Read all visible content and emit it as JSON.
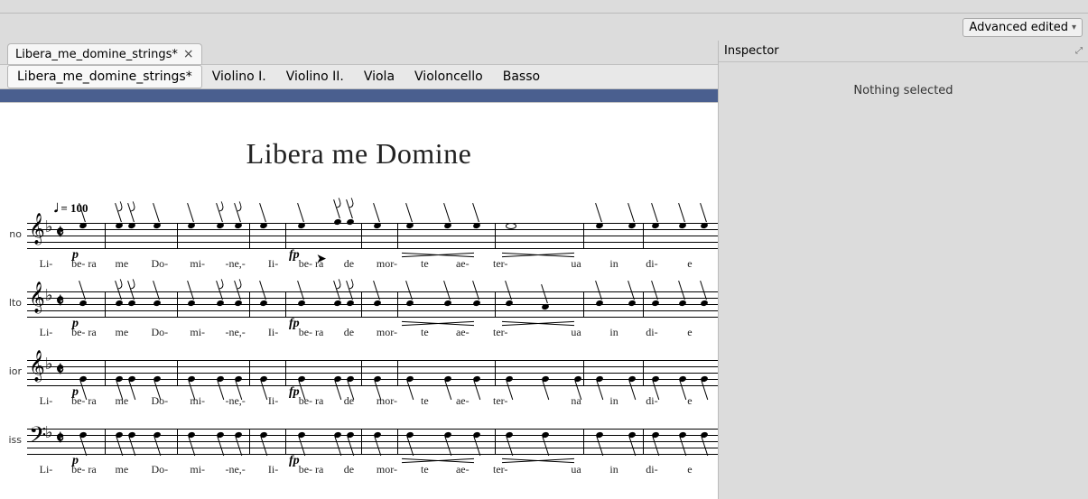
{
  "advanced_button": "Advanced edited",
  "file_tab": "Libera_me_domine_strings*",
  "file_tab_close": "×",
  "part_tabs": [
    "Libera_me_domine_strings*",
    "Violino I.",
    "Violino II.",
    "Viola",
    "Violoncello",
    "Basso"
  ],
  "active_part_tab": 0,
  "score_title": "Libera me Domine",
  "tempo": "𝅘𝅥 = 100",
  "staff_labels": [
    "no",
    "lto",
    "ior",
    "iss"
  ],
  "dynamics_p": "p",
  "dynamics_fp": "fp",
  "lyrics_row": [
    "Li-",
    "be- ra",
    "me",
    "Do-",
    "mi-",
    "-ne,-",
    "Ii-",
    "be- ra",
    "de",
    "mor-",
    "te",
    "ae-",
    "ter-",
    "",
    "ua",
    "in",
    "di-",
    "e"
  ],
  "lyrics_row_tenor": [
    "Li-",
    "be- ra",
    "me",
    "Do-",
    "mi-",
    "-ne,-",
    "Ii-",
    "be- ra",
    "de",
    "mor-",
    "te",
    "ae-",
    "ter-",
    "",
    "na",
    "in",
    "di-",
    "e"
  ],
  "inspector": {
    "title": "Inspector",
    "status": "Nothing selected"
  }
}
